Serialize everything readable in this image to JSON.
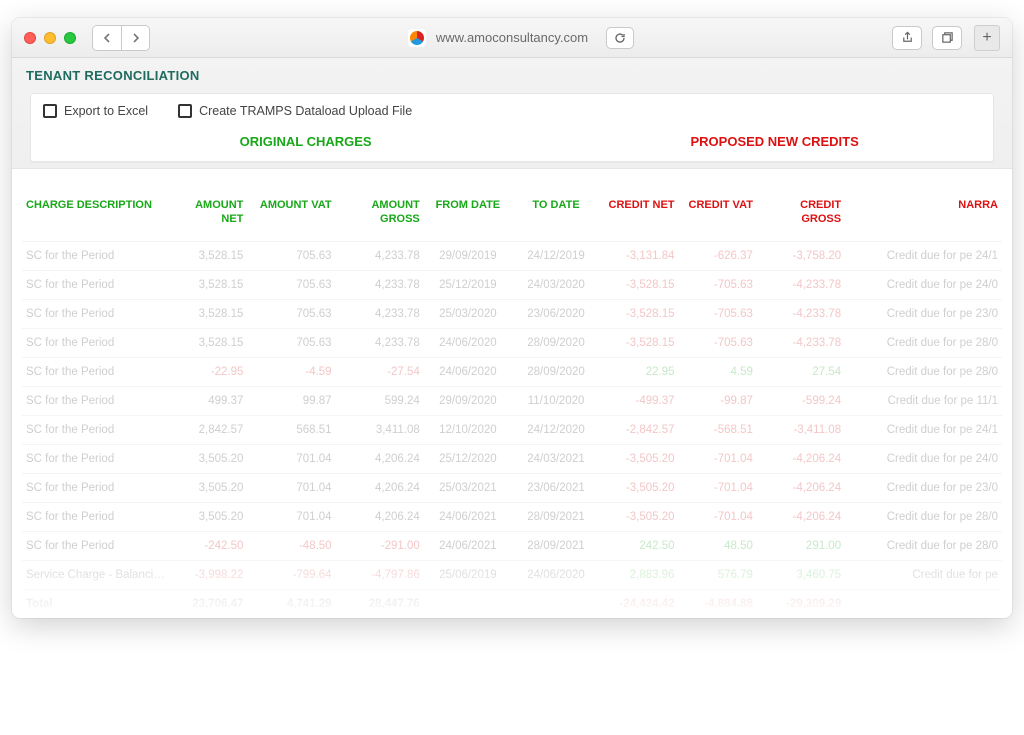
{
  "browser": {
    "url": "www.amoconsultancy.com"
  },
  "page": {
    "title": "TENANT RECONCILIATION",
    "toolbar": {
      "export_excel": "Export to Excel",
      "create_tramps": "Create TRAMPS Dataload Upload File"
    },
    "sections": {
      "original": "ORIGINAL CHARGES",
      "proposed": "PROPOSED NEW CREDITS"
    }
  },
  "columns": {
    "charge_desc": "CHARGE DESCRIPTION",
    "amount_net": "AMOUNT NET",
    "amount_vat": "AMOUNT VAT",
    "amount_gross": "AMOUNT GROSS",
    "from_date": "FROM DATE",
    "to_date": "TO DATE",
    "credit_net": "CREDIT NET",
    "credit_vat": "CREDIT VAT",
    "credit_gross": "CREDIT GROSS",
    "narrative": "NARRA"
  },
  "rows": [
    {
      "desc": "SC for the Period",
      "amt_net": "3,528.15",
      "amt_vat": "705.63",
      "amt_gross": "4,233.78",
      "from": "29/09/2019",
      "to": "24/12/2019",
      "cr_net": "-3,131.84",
      "cr_vat": "-626.37",
      "cr_gross": "-3,758.20",
      "narr": "Credit due for pe 24/1"
    },
    {
      "desc": "SC for the Period",
      "amt_net": "3,528.15",
      "amt_vat": "705.63",
      "amt_gross": "4,233.78",
      "from": "25/12/2019",
      "to": "24/03/2020",
      "cr_net": "-3,528.15",
      "cr_vat": "-705.63",
      "cr_gross": "-4,233.78",
      "narr": "Credit due for pe 24/0"
    },
    {
      "desc": "SC for the Period",
      "amt_net": "3,528.15",
      "amt_vat": "705.63",
      "amt_gross": "4,233.78",
      "from": "25/03/2020",
      "to": "23/06/2020",
      "cr_net": "-3,528.15",
      "cr_vat": "-705.63",
      "cr_gross": "-4,233.78",
      "narr": "Credit due for pe 23/0"
    },
    {
      "desc": "SC for the Period",
      "amt_net": "3,528.15",
      "amt_vat": "705.63",
      "amt_gross": "4,233.78",
      "from": "24/06/2020",
      "to": "28/09/2020",
      "cr_net": "-3,528.15",
      "cr_vat": "-705.63",
      "cr_gross": "-4,233.78",
      "narr": "Credit due for pe 28/0"
    },
    {
      "desc": "SC for the Period",
      "amt_net": "-22.95",
      "amt_vat": "-4.59",
      "amt_gross": "-27.54",
      "from": "24/06/2020",
      "to": "28/09/2020",
      "cr_net": "22.95",
      "cr_vat": "4.59",
      "cr_gross": "27.54",
      "narr": "Credit due for pe 28/0",
      "neg_amt": true,
      "pos_cr": true
    },
    {
      "desc": "SC for the Period",
      "amt_net": "499.37",
      "amt_vat": "99.87",
      "amt_gross": "599.24",
      "from": "29/09/2020",
      "to": "11/10/2020",
      "cr_net": "-499.37",
      "cr_vat": "-99.87",
      "cr_gross": "-599.24",
      "narr": "Credit due for pe 11/1"
    },
    {
      "desc": "SC for the Period",
      "amt_net": "2,842.57",
      "amt_vat": "568.51",
      "amt_gross": "3,411.08",
      "from": "12/10/2020",
      "to": "24/12/2020",
      "cr_net": "-2,842.57",
      "cr_vat": "-568.51",
      "cr_gross": "-3,411.08",
      "narr": "Credit due for pe 24/1"
    },
    {
      "desc": "SC for the Period",
      "amt_net": "3,505.20",
      "amt_vat": "701.04",
      "amt_gross": "4,206.24",
      "from": "25/12/2020",
      "to": "24/03/2021",
      "cr_net": "-3,505.20",
      "cr_vat": "-701.04",
      "cr_gross": "-4,206.24",
      "narr": "Credit due for pe 24/0"
    },
    {
      "desc": "SC for the Period",
      "amt_net": "3,505.20",
      "amt_vat": "701.04",
      "amt_gross": "4,206.24",
      "from": "25/03/2021",
      "to": "23/06/2021",
      "cr_net": "-3,505.20",
      "cr_vat": "-701.04",
      "cr_gross": "-4,206.24",
      "narr": "Credit due for pe 23/0"
    },
    {
      "desc": "SC for the Period",
      "amt_net": "3,505.20",
      "amt_vat": "701.04",
      "amt_gross": "4,206.24",
      "from": "24/06/2021",
      "to": "28/09/2021",
      "cr_net": "-3,505.20",
      "cr_vat": "-701.04",
      "cr_gross": "-4,206.24",
      "narr": "Credit due for pe 28/0"
    },
    {
      "desc": "SC for the Period",
      "amt_net": "-242.50",
      "amt_vat": "-48.50",
      "amt_gross": "-291.00",
      "from": "24/06/2021",
      "to": "28/09/2021",
      "cr_net": "242.50",
      "cr_vat": "48.50",
      "cr_gross": "291.00",
      "narr": "Credit due for pe 28/0",
      "neg_amt": true,
      "pos_cr": true
    },
    {
      "desc": "Service Charge - Balancing",
      "amt_net": "-3,998.22",
      "amt_vat": "-799.64",
      "amt_gross": "-4,797.86",
      "from": "25/06/2019",
      "to": "24/06/2020",
      "cr_net": "2,883.96",
      "cr_vat": "576.79",
      "cr_gross": "3,460.75",
      "narr": "Credit due for pe",
      "neg_amt": true,
      "pos_cr": true
    }
  ],
  "total": {
    "label": "Total",
    "amt_net": "23,706.47",
    "amt_vat": "4,741.29",
    "amt_gross": "28,447.76",
    "cr_net": "-24,424.42",
    "cr_vat": "-4,884.88",
    "cr_gross": "-29,309.29"
  }
}
